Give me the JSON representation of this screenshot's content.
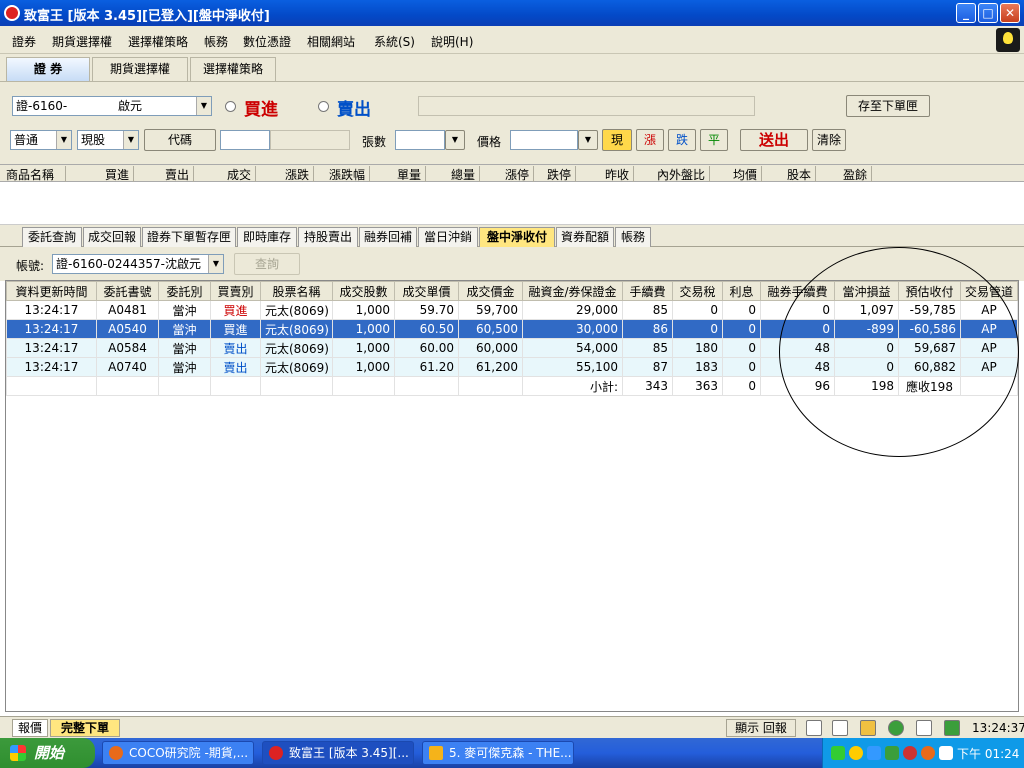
{
  "window": {
    "title": "致富王 [版本 3.45][已登入][盤中淨收付]",
    "min": "_",
    "max": "□",
    "close": "✕"
  },
  "menu": [
    "證券",
    "期貨選擇權",
    "選擇權策略",
    "帳務",
    "數位憑證",
    "相關網站",
    "系統(S)",
    "說明(H)"
  ],
  "top_tabs": [
    "證 券",
    "期貨選擇權",
    "選擇權策略"
  ],
  "order": {
    "account": "證-6160-",
    "account_name": "啟元",
    "buy_label": "買進",
    "sell_label": "賣出",
    "save_button": "存至下單匣",
    "type": "普通",
    "kind": "現股",
    "code_button": "代碼",
    "qty_label": "張數",
    "price_label": "價格",
    "btn_now": "現",
    "btn_up": "漲",
    "btn_down": "跌",
    "btn_flat": "平",
    "send_button": "送出",
    "clear_button": "清除"
  },
  "quote_headers": [
    "商品名稱",
    "買進",
    "賣出",
    "成交",
    "漲跌",
    "漲跌幅",
    "單量",
    "總量",
    "漲停",
    "跌停",
    "昨收",
    "內外盤比",
    "均價",
    "股本",
    "盈餘"
  ],
  "sub_tabs": [
    "委託查詢",
    "成交回報",
    "證券下單暫存匣",
    "即時庫存",
    "持股賣出",
    "融券回補",
    "當日沖銷",
    "盤中淨收付",
    "資券配額",
    "帳務"
  ],
  "account_bar": {
    "label": "帳號:",
    "value": "證-6160-0244357-沈啟元",
    "query_button": "查詢"
  },
  "grid": {
    "headers": [
      "資料更新時間",
      "委託書號",
      "委託別",
      "買賣別",
      "股票名稱",
      "成交股數",
      "成交單價",
      "成交價金",
      "融資金/券保證金",
      "手續費",
      "交易稅",
      "利息",
      "融券手續費",
      "當沖損益",
      "預估收付",
      "交易管道"
    ],
    "rows": [
      [
        "13:24:17",
        "A0481",
        "當沖",
        "買進",
        "元太(8069)",
        "1,000",
        "59.70",
        "59,700",
        "29,000",
        "85",
        "0",
        "0",
        "0",
        "1,097",
        "-59,785",
        "AP"
      ],
      [
        "13:24:17",
        "A0540",
        "當沖",
        "買進",
        "元太(8069)",
        "1,000",
        "60.50",
        "60,500",
        "30,000",
        "86",
        "0",
        "0",
        "0",
        "-899",
        "-60,586",
        "AP"
      ],
      [
        "13:24:17",
        "A0584",
        "當沖",
        "賣出",
        "元太(8069)",
        "1,000",
        "60.00",
        "60,000",
        "54,000",
        "85",
        "180",
        "0",
        "48",
        "0",
        "59,687",
        "AP"
      ],
      [
        "13:24:17",
        "A0740",
        "當沖",
        "賣出",
        "元太(8069)",
        "1,000",
        "61.20",
        "61,200",
        "55,100",
        "87",
        "183",
        "0",
        "48",
        "0",
        "60,882",
        "AP"
      ]
    ],
    "subtotal": {
      "label": "小計:",
      "fee": "343",
      "tax": "363",
      "interest": "0",
      "short_fee": "96",
      "pl": "198",
      "receivable": "應收198"
    },
    "selected_row": 1
  },
  "status": {
    "left_tabs": [
      "報價",
      "完整下單"
    ],
    "show_report": "顯示 回報",
    "clock": "13:24:37"
  },
  "taskbar": {
    "start": "開始",
    "tasks": [
      "COCO研究院 -期貨,...",
      "致富王 [版本 3.45][...",
      "5. 麥可傑克森 - THE..."
    ],
    "clock": "下午 01:24"
  },
  "colors": {
    "title_blue": "#0349c7",
    "buy": "#cc0000",
    "sell": "#0050c8",
    "selected": "#316ac5",
    "active_tab": "#ffe680"
  }
}
